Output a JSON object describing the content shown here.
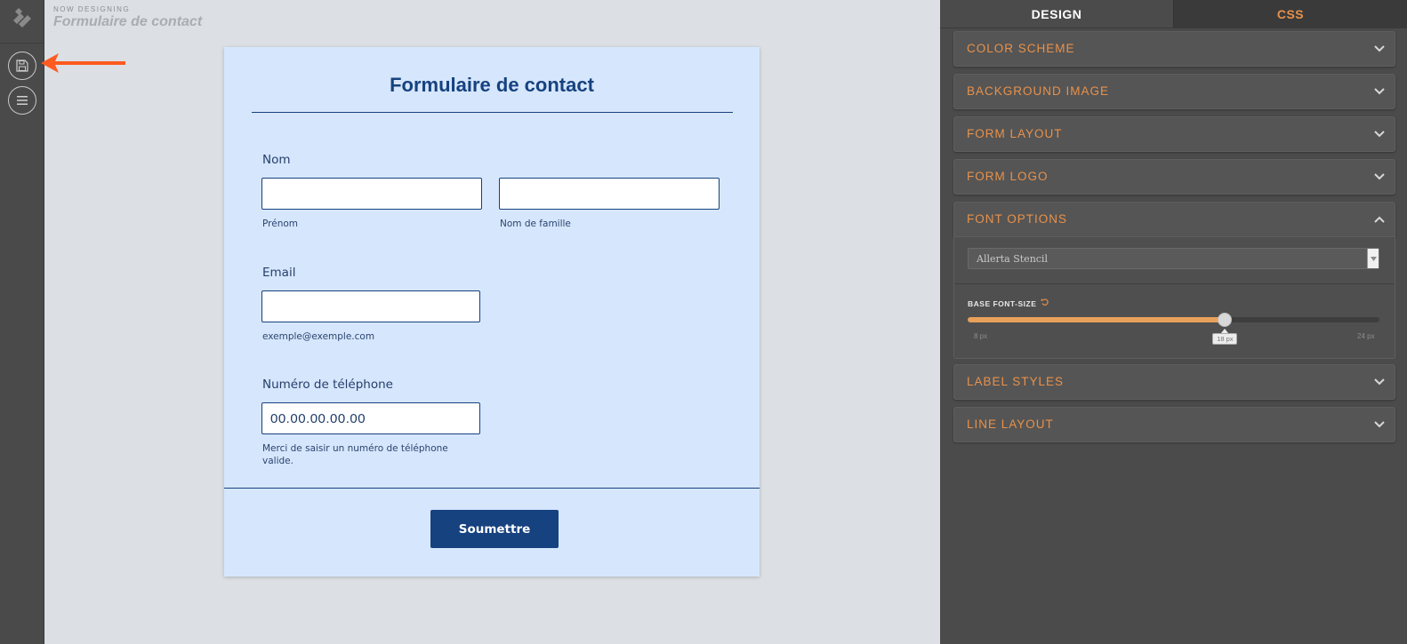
{
  "header": {
    "subtitle": "NOW DESIGNING",
    "title": "Formulaire de contact"
  },
  "rail": {
    "icons": [
      "logo-icon",
      "save-icon",
      "menu-icon"
    ]
  },
  "form": {
    "title": "Formulaire de contact",
    "name": {
      "label": "Nom",
      "first_sublabel": "Prénom",
      "last_sublabel": "Nom de famille",
      "first_value": "",
      "last_value": ""
    },
    "email": {
      "label": "Email",
      "value": "",
      "sublabel": "exemple@exemple.com"
    },
    "phone": {
      "label": "Numéro de téléphone",
      "value": "00.00.00.00.00",
      "sublabel_line1": "Merci de saisir un numéro de téléphone",
      "sublabel_line2": "valide."
    },
    "submit_label": "Soumettre"
  },
  "panel": {
    "tabs": {
      "design": "DESIGN",
      "css": "CSS",
      "active": "DESIGN"
    },
    "sections": [
      {
        "label": "COLOR SCHEME",
        "expanded": false
      },
      {
        "label": "BACKGROUND IMAGE",
        "expanded": false
      },
      {
        "label": "FORM LAYOUT",
        "expanded": false
      },
      {
        "label": "FORM LOGO",
        "expanded": false
      },
      {
        "label": "FONT OPTIONS",
        "expanded": true
      },
      {
        "label": "LABEL STYLES",
        "expanded": false
      },
      {
        "label": "LINE LAYOUT",
        "expanded": false
      }
    ],
    "font_options": {
      "font_family": "Allerta Stencil",
      "base_font_size_label": "BASE FONT-SIZE",
      "slider_min": "8 px",
      "slider_max": "24 px",
      "slider_value": "18 px",
      "slider_min_num": 8,
      "slider_max_num": 24,
      "slider_value_num": 18
    }
  },
  "colors": {
    "accent_orange": "#e8914a",
    "form_blue": "#16427f",
    "form_bg": "#d6e6fc",
    "annotation_arrow": "#ff5a1f"
  }
}
